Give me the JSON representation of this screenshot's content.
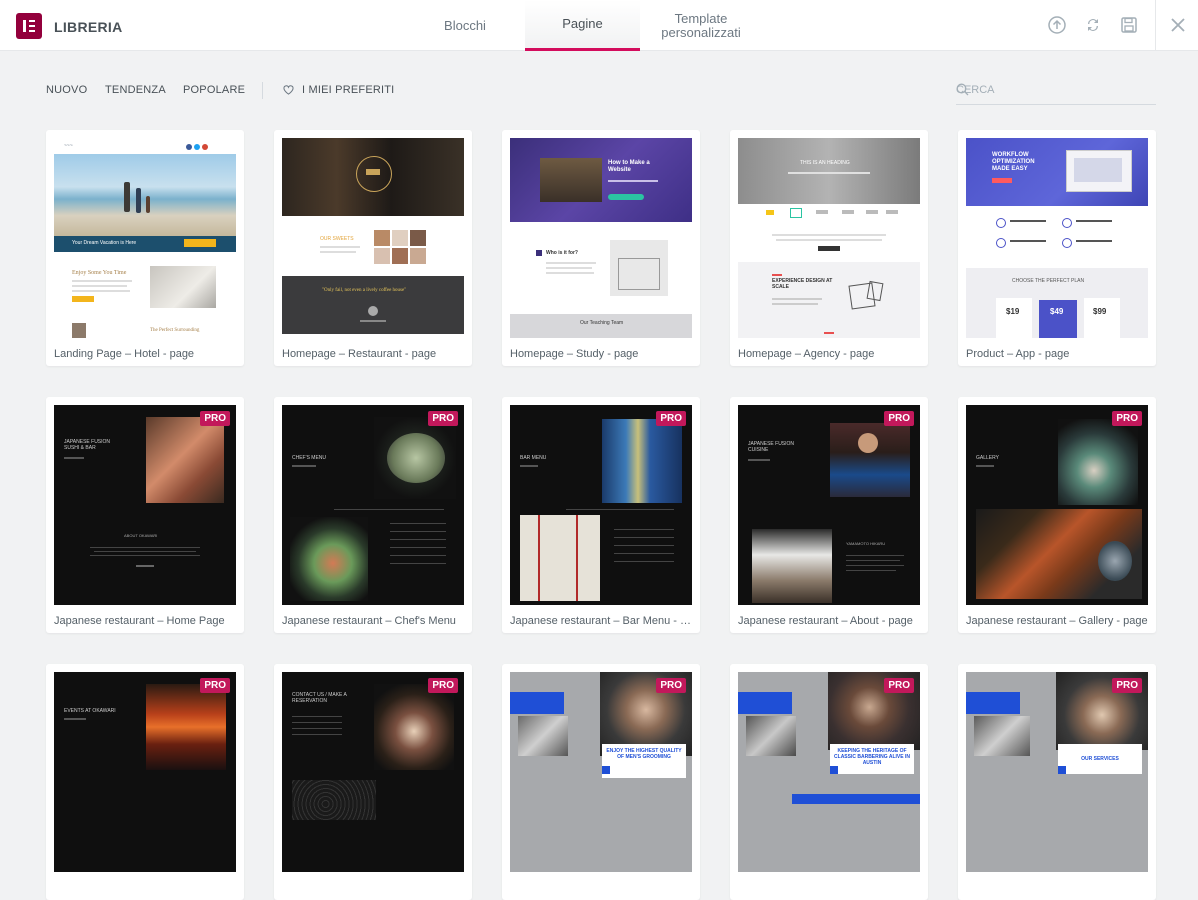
{
  "header": {
    "title": "LIBRERIA",
    "tabs": [
      {
        "label": "Blocchi"
      },
      {
        "label": "Pagine",
        "active": true
      },
      {
        "label": "Template personalizzati"
      }
    ],
    "icons": [
      "upload-icon",
      "sync-icon",
      "save-icon",
      "close-icon"
    ]
  },
  "filters": {
    "items": [
      "NUOVO",
      "TENDENZA",
      "POPOLARE"
    ],
    "favorites": "I MIEI PREFERITI"
  },
  "search": {
    "placeholder": "CERCA"
  },
  "colors": {
    "accent": "#d30c5c",
    "logo": "#93003c",
    "pro_badge": "#c2185b"
  },
  "templates": [
    {
      "label": "Landing Page – Hotel - page",
      "pro": false
    },
    {
      "label": "Homepage – Restaurant - page",
      "pro": false
    },
    {
      "label": "Homepage – Study - page",
      "pro": false
    },
    {
      "label": "Homepage – Agency - page",
      "pro": false
    },
    {
      "label": "Product – App - page",
      "pro": false
    },
    {
      "label": "Japanese restaurant – Home Page",
      "pro": true
    },
    {
      "label": "Japanese restaurant – Chef's Menu",
      "pro": true
    },
    {
      "label": "Japanese restaurant – Bar Menu - page",
      "pro": true
    },
    {
      "label": "Japanese restaurant – About - page",
      "pro": true
    },
    {
      "label": "Japanese restaurant – Gallery - page",
      "pro": true
    },
    {
      "label": "",
      "pro": true
    },
    {
      "label": "",
      "pro": true
    },
    {
      "label": "",
      "pro": true
    },
    {
      "label": "",
      "pro": true
    },
    {
      "label": "",
      "pro": true
    }
  ],
  "pro_label": "PRO",
  "thumb_text": {
    "hotel_banner": "Your Dream Vacation is Here",
    "hotel_heading": "Enjoy Some You Time",
    "hotel_footer": "The Perfect Surrounding",
    "rest_heading": "OUR SWEETS",
    "rest_quote": "\"Only fail, not even a lively coffee house\"",
    "study_title": "How to Make a Website",
    "study_sub": "Who is it for?",
    "study_footer": "Our Teaching Team",
    "agency_hero": "THIS IS AN HEADING",
    "agency_section": "EXPERIENCE DESIGN AT SCALE",
    "app_hero": "WORKFLOW OPTIMIZATION MADE EASY",
    "app_plan": "CHOOSE THE PERFECT PLAN",
    "app_prices": [
      "$19",
      "$49",
      "$99"
    ],
    "jp_home": "JAPANESE FUSION SUSHI & BAR",
    "jp_home2": "ABOUT OKAWARI",
    "jp_chef": "CHEF'S MENU",
    "jp_bar": "BAR MENU",
    "jp_about": "JAPANESE FUSION CUISINE",
    "jp_about2": "YAMAMOTO HIKARU",
    "jp_gallery": "GALLERY",
    "jp_events": "EVENTS AT OKAWARI",
    "jp_contact": "CONTACT US / MAKE A RESERVATION",
    "barber1": "ENJOY THE HIGHEST QUALITY OF MEN'S GROOMING",
    "barber2": "KEEPING THE HERITAGE OF CLASSIC BARBERING ALIVE IN AUSTIN",
    "barber3": "OUR SERVICES"
  }
}
